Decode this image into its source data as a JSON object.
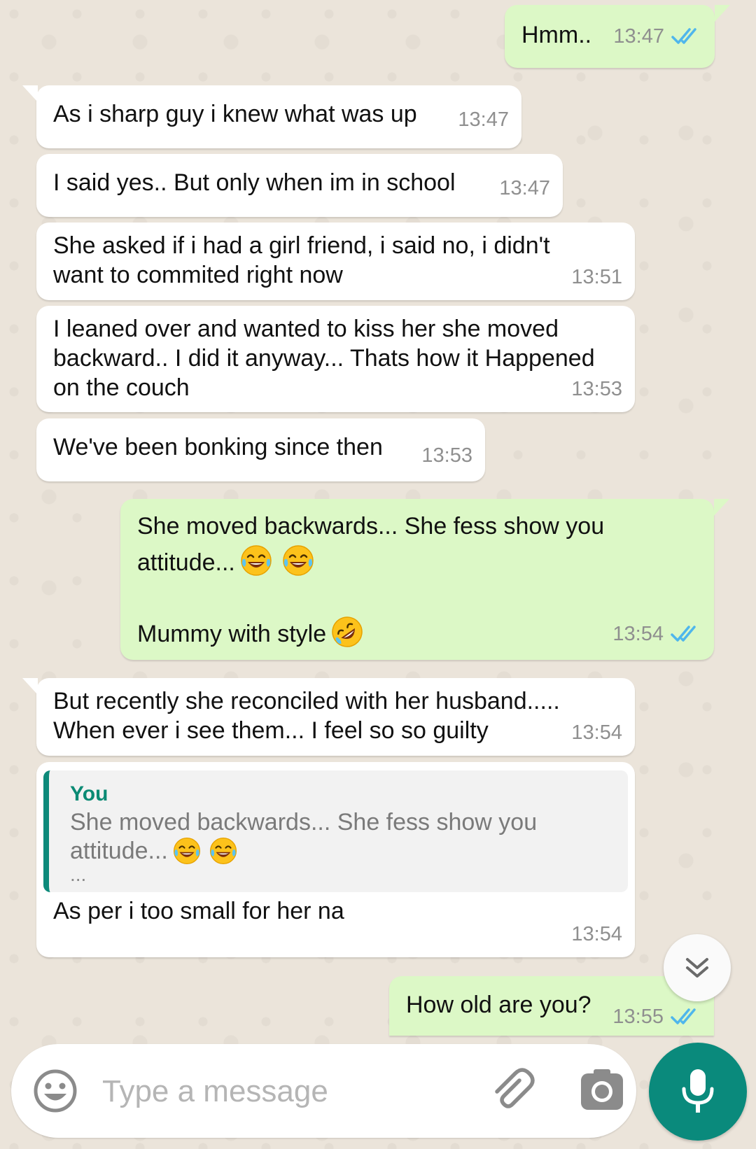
{
  "messages": [
    {
      "direction": "out",
      "text": "Hmm..",
      "time": "13:47",
      "status": "read"
    },
    {
      "direction": "in",
      "text": "As i sharp guy i knew what was up",
      "time": "13:47"
    },
    {
      "direction": "in",
      "text": "I said yes.. But only when im in school",
      "time": "13:47"
    },
    {
      "direction": "in",
      "text": "She asked if i had a girl friend, i said no, i didn't\nwant to commited right now",
      "time": "13:51"
    },
    {
      "direction": "in",
      "text": "I leaned over and wanted to kiss her she moved\nbackward.. I did it anyway... Thats how it Happened\non the couch",
      "time": "13:53"
    },
    {
      "direction": "in",
      "text": "We've been bonking since then",
      "time": "13:53"
    },
    {
      "direction": "out",
      "text_line1": "She moved backwards... She fess show you",
      "text_line2": "attitude...",
      "text_line3": "Mummy with style",
      "time": "13:54",
      "status": "read"
    },
    {
      "direction": "in",
      "text": "But recently she reconciled with her husband.....\nWhen ever i see them... I feel so so guilty",
      "time": "13:54"
    },
    {
      "direction": "in",
      "quote_author": "You",
      "quote_text": "She moved backwards... She fess show you\nattitude...",
      "quote_more": "...",
      "text": "As per i too small for her na",
      "time": "13:54"
    },
    {
      "direction": "out",
      "text": "How old are you?",
      "time": "13:55",
      "status": "read"
    }
  ],
  "composer": {
    "placeholder": "Type a message"
  },
  "colors": {
    "incoming_bubble": "#ffffff",
    "outgoing_bubble": "#dcf8c6",
    "read_ticks": "#4fb6ec",
    "accent": "#0a8a7c",
    "quote_author": "#0b8a74"
  },
  "icons": {
    "emoji_button": "smiley-icon",
    "attach_button": "paperclip-icon",
    "camera_button": "camera-icon",
    "mic_button": "microphone-icon",
    "scroll_button": "double-chevron-down-icon",
    "status": "double-check-icon",
    "emoji_laugh": "face-with-tears-of-joy",
    "emoji_rofl": "rolling-on-the-floor-laughing"
  }
}
